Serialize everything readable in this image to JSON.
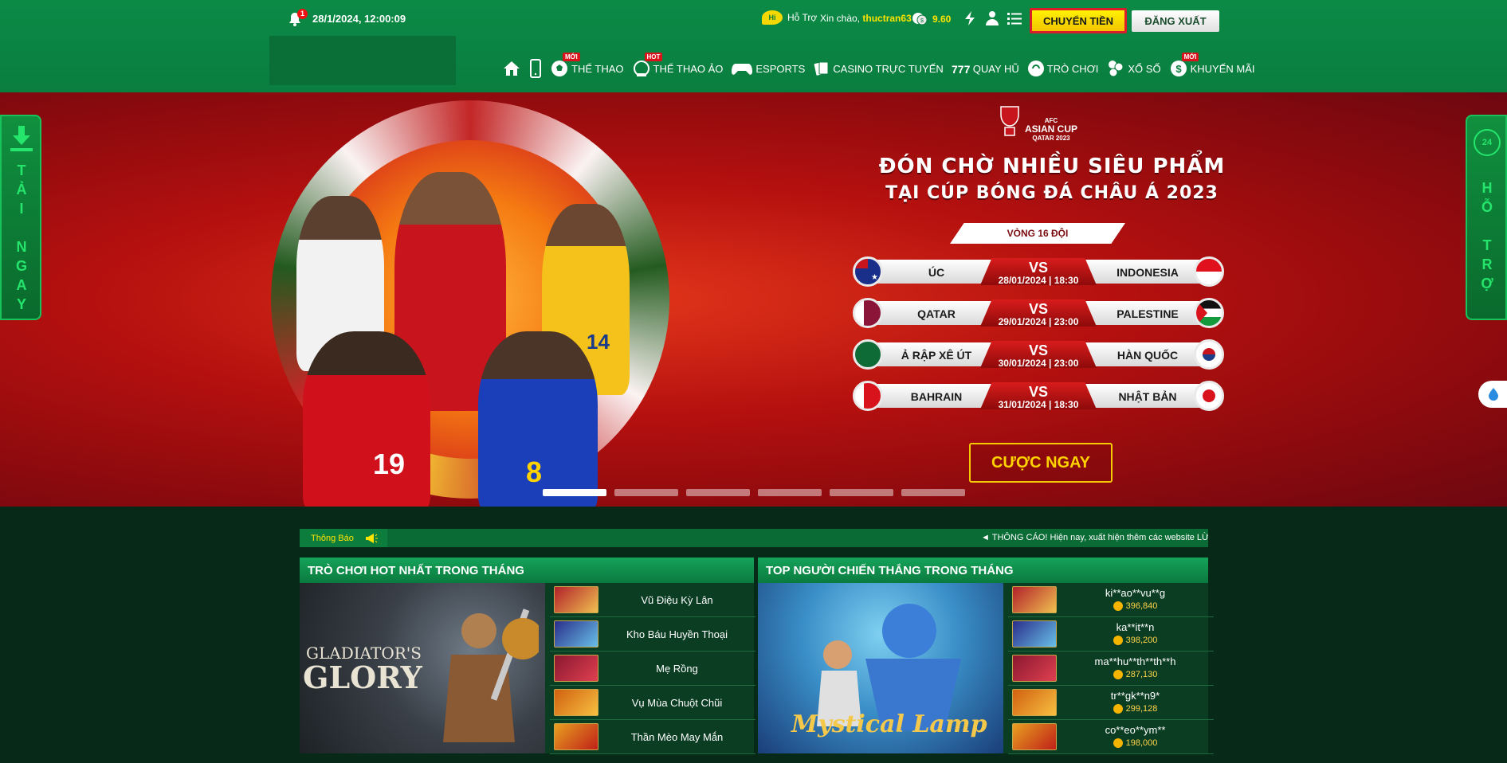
{
  "header": {
    "notification_count": "1",
    "datetime": "28/1/2024, 12:00:09",
    "support_hi": "Hi",
    "support_label": "Hỗ Trợ",
    "greeting": "Xin chào,",
    "username": "thuctran63",
    "balance": "9.60",
    "transfer_button": "CHUYỂN TIỀN",
    "logout_button": "ĐĂNG XUẤT"
  },
  "nav": {
    "items": [
      {
        "label": "THỂ THAO",
        "tag": "MỚI"
      },
      {
        "label": "THỂ THAO ẢO",
        "tag": "HOT"
      },
      {
        "label": "ESPORTS",
        "tag": ""
      },
      {
        "label": "CASINO TRỰC TUYẾN",
        "tag": ""
      },
      {
        "label": "QUAY HŨ",
        "tag": ""
      },
      {
        "label": "TRÒ CHƠI",
        "tag": ""
      },
      {
        "label": "XỔ SỐ",
        "tag": ""
      },
      {
        "label": "KHUYẾN MÃI",
        "tag": "MỚI"
      }
    ]
  },
  "banner": {
    "event_logo_line1": "AFC",
    "event_logo_line2": "ASIAN CUP",
    "event_logo_line3": "QATAR 2023",
    "title_line1": "ĐÓN CHỜ NHIỀU SIÊU PHẨM",
    "title_line2": "TẠI CÚP BÓNG ĐÁ CHÂU Á 2023",
    "round": "VÒNG 16 ĐỘI",
    "vs_label": "VS",
    "matches": [
      {
        "home": "ÚC",
        "away": "INDONESIA",
        "date": "28/01/2024 | 18:30"
      },
      {
        "home": "QATAR",
        "away": "PALESTINE",
        "date": "29/01/2024 | 23:00"
      },
      {
        "home": "Ả RẬP XÊ ÚT",
        "away": "HÀN QUỐC",
        "date": "30/01/2024 | 23:00"
      },
      {
        "home": "BAHRAIN",
        "away": "NHẬT BẢN",
        "date": "31/01/2024 | 18:30"
      }
    ],
    "cta": "CƯỢC NGAY",
    "jersey_numbers": [
      "19",
      "8",
      "14"
    ]
  },
  "side": {
    "left_label": "TẢI NGAY",
    "right_label": "HỖ TRỢ",
    "right_badge": "24"
  },
  "notice": {
    "label": "Thông Báo",
    "text": "◄ THÔNG CÁO! Hiện nay, xuất hiện thêm các website LỪA"
  },
  "hot_games": {
    "title": "TRÒ CHƠI HOT NHẤT TRONG THÁNG",
    "feature_title_1": "GLADIATOR'S",
    "feature_title_2": "GLORY",
    "items": [
      "Vũ Điệu Kỳ Lân",
      "Kho Báu Huyền Thoại",
      "Mẹ Rồng",
      "Vụ Mùa Chuột Chũi",
      "Thần Mèo May Mắn"
    ]
  },
  "top_winners": {
    "title": "TOP NGƯỜI CHIẾN THẮNG TRONG THÁNG",
    "feature_title": "Mystical Lamp",
    "items": [
      {
        "name": "ki**ao**vu**g",
        "amount": "396,840"
      },
      {
        "name": "ka**it**n",
        "amount": "398,200"
      },
      {
        "name": "ma**hu**th**th**h",
        "amount": "287,130"
      },
      {
        "name": "tr**gk**n9*",
        "amount": "299,128"
      },
      {
        "name": "co**eo**ym**",
        "amount": "198,000"
      }
    ]
  },
  "colors": {
    "header_green": "#0a7e3f",
    "accent_yellow": "#ffe400",
    "banner_red": "#b5100f",
    "highlight_border": "#d81c2a"
  }
}
